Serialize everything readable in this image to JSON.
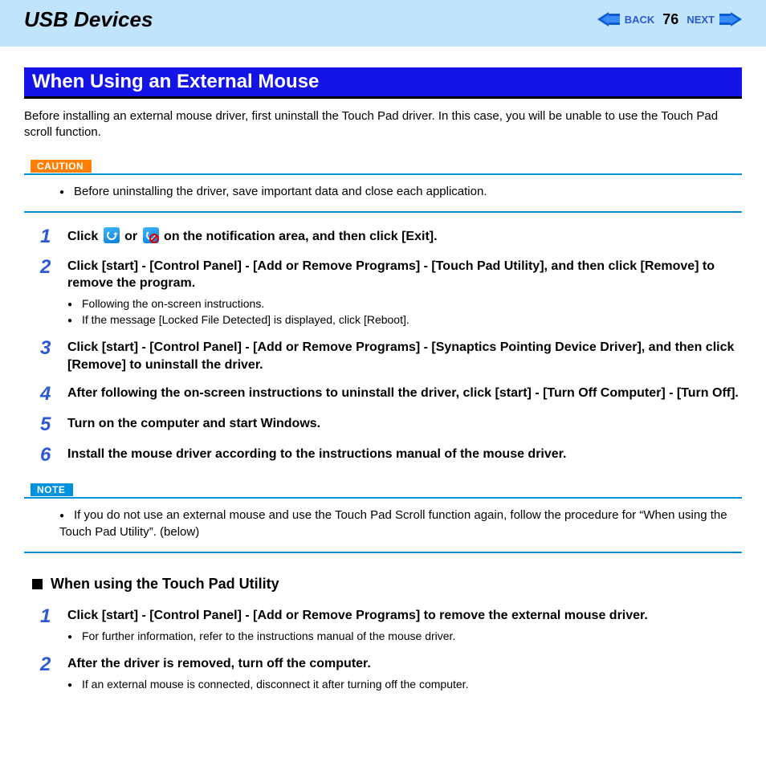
{
  "header": {
    "title": "USB Devices",
    "back_label": "BACK",
    "next_label": "NEXT",
    "page_number": "76"
  },
  "section": {
    "banner": "When Using an External Mouse",
    "intro": "Before installing an external mouse driver, first uninstall the Touch Pad driver. In this case, you will be unable to use the Touch Pad scroll function."
  },
  "caution": {
    "label": "CAUTION",
    "items": [
      "Before uninstalling the driver, save important data and close each application."
    ]
  },
  "steps": [
    {
      "num": "1",
      "pre": "Click ",
      "mid": " or ",
      "post": " on the notification area, and then click [Exit].",
      "has_icons": true,
      "bullets": []
    },
    {
      "num": "2",
      "text": "Click [start] - [Control Panel] - [Add or Remove Programs] - [Touch Pad Utility], and then click [Remove] to remove the program.",
      "bullets": [
        "Following the on-screen instructions.",
        "If the message [Locked File Detected] is displayed, click [Reboot]."
      ]
    },
    {
      "num": "3",
      "text": "Click [start] - [Control Panel] - [Add or Remove Programs] - [Synaptics Pointing Device Driver], and then click [Remove] to uninstall the driver.",
      "bullets": []
    },
    {
      "num": "4",
      "text": "After following the on-screen instructions to uninstall the driver, click [start] - [Turn Off Computer] - [Turn Off].",
      "bullets": []
    },
    {
      "num": "5",
      "text": "Turn on the computer and start Windows.",
      "bullets": []
    },
    {
      "num": "6",
      "text": "Install the mouse driver according to the instructions manual of the mouse driver.",
      "bullets": []
    }
  ],
  "note": {
    "label": "NOTE",
    "items": [
      "If you do not use an external mouse and use the Touch Pad Scroll function again, follow the procedure for “When using the Touch Pad Utility”. (below)"
    ]
  },
  "sub": {
    "heading": "When using the Touch Pad Utility",
    "steps": [
      {
        "num": "1",
        "text": "Click [start] - [Control Panel] - [Add or Remove Programs] to remove the external mouse driver.",
        "bullets": [
          "For further information, refer to the instructions manual of the mouse driver."
        ]
      },
      {
        "num": "2",
        "text": "After the driver is removed, turn off the computer.",
        "bullets": [
          "If an external mouse is connected, disconnect it after turning off the computer."
        ]
      }
    ]
  }
}
